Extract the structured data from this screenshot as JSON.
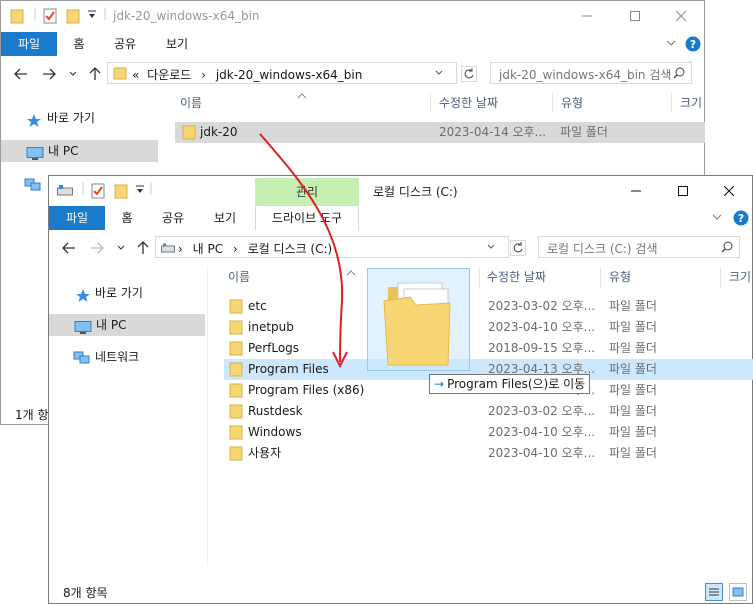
{
  "back_window": {
    "title": "jdk-20_windows-x64_bin",
    "ribbon_tabs": [
      "파일",
      "홈",
      "공유",
      "보기"
    ],
    "address": {
      "overflow": "«",
      "crumbs": [
        "다운로드",
        "jdk-20_windows-x64_bin"
      ]
    },
    "search_placeholder": "jdk-20_windows-x64_bin 검색",
    "nav": [
      "바로 가기",
      "내 PC"
    ],
    "columns": [
      "이름",
      "수정한 날짜",
      "유형",
      "크기"
    ],
    "files": [
      {
        "name": "jdk-20",
        "date": "2023-04-14 오후...",
        "type": "파일 폴더"
      }
    ],
    "status": "1개 항"
  },
  "front_window": {
    "title": "로컬 디스크 (C:)",
    "manage_label": "관리",
    "ribbon_tabs": [
      "파일",
      "홈",
      "공유",
      "보기",
      "드라이브 도구"
    ],
    "address": {
      "crumbs": [
        "내 PC",
        "로컬 디스크 (C:)"
      ]
    },
    "search_placeholder": "로컬 디스크 (C:) 검색",
    "nav": [
      "바로 가기",
      "내 PC",
      "네트워크"
    ],
    "columns": [
      "이름",
      "수정한 날짜",
      "유형",
      "크기"
    ],
    "files": [
      {
        "name": "etc",
        "date": "2023-03-02 오후...",
        "type": "파일 폴더"
      },
      {
        "name": "inetpub",
        "date": "2023-04-10 오후...",
        "type": "파일 폴더"
      },
      {
        "name": "PerfLogs",
        "date": "2018-09-15 오후...",
        "type": "파일 폴더"
      },
      {
        "name": "Program Files",
        "date": "2023-04-13 오후...",
        "type": "파일 폴더"
      },
      {
        "name": "Program Files (x86)",
        "date": "2023-04-10 오후...",
        "type": "파일 폴더"
      },
      {
        "name": "Rustdesk",
        "date": "2023-03-02 오후...",
        "type": "파일 폴더"
      },
      {
        "name": "Windows",
        "date": "2023-04-10 오후...",
        "type": "파일 폴더"
      },
      {
        "name": "사용자",
        "date": "2023-04-10 오후...",
        "type": "파일 폴더"
      }
    ],
    "status": "8개 항목"
  },
  "drag": {
    "tooltip": "Program Files(으)로 이동"
  },
  "icons": {
    "folder": "folder-icon",
    "star": "quick-access-star-icon",
    "pc": "this-pc-icon",
    "network": "network-icon",
    "help": "help-icon"
  },
  "colors": {
    "accent": "#1979ca",
    "hover": "#cce8ff",
    "manage": "#c6efb3",
    "annotation": "#e02020",
    "folder": "#f7d674"
  }
}
